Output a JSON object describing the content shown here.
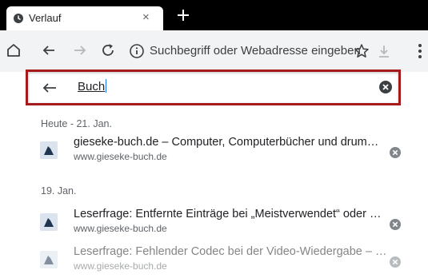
{
  "tab": {
    "title": "Verlauf",
    "close": "×"
  },
  "toolbar": {
    "omnibox_placeholder": "Suchbegriff oder Webadresse eingeben"
  },
  "history_search": {
    "query": "Buch"
  },
  "sections": [
    {
      "date": "Heute - 21. Jan.",
      "entries": [
        {
          "title": "gieseke-buch.de – Computer, Computerbücher und drum…",
          "url": "www.gieseke-buch.de"
        }
      ]
    },
    {
      "date": "19. Jan.",
      "entries": [
        {
          "title": "Leserfrage: Entfernte Einträge bei „Meistverwendet“ oder …",
          "url": "www.gieseke-buch.de"
        },
        {
          "title": "Leserfrage: Fehlender Codec bei der Video-Wiedergabe – …",
          "url": "www.gieseke-buch.de"
        }
      ]
    }
  ],
  "colors": {
    "highlight_border": "#a51b1b",
    "toolbar_bg": "#f1f3f4",
    "tabstrip_bg": "#000000"
  }
}
